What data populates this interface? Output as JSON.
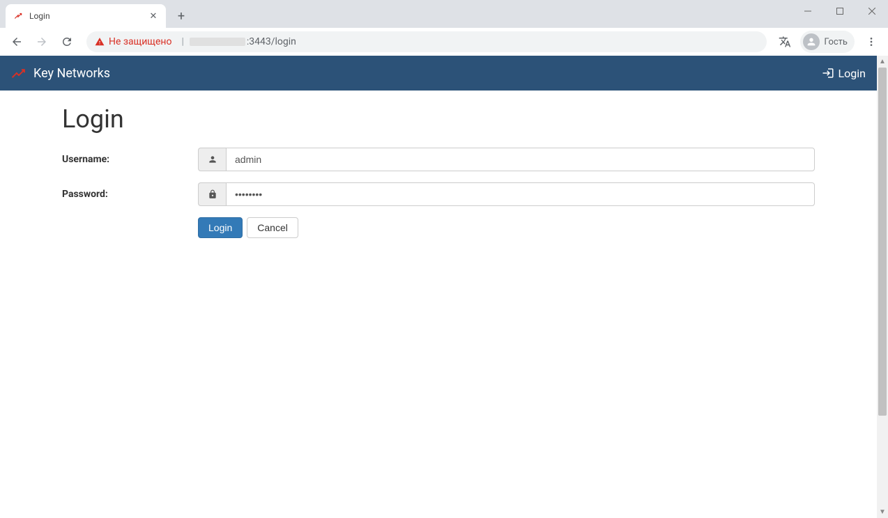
{
  "browser": {
    "tab": {
      "title": "Login"
    },
    "security_text": "Не защищено",
    "url_suffix": ":3443/login",
    "guest_label": "Гость"
  },
  "header": {
    "brand": "Key Networks",
    "login_link": "Login"
  },
  "page": {
    "title": "Login",
    "username_label": "Username:",
    "username_value": "admin",
    "password_label": "Password:",
    "password_value": "••••••••",
    "login_button": "Login",
    "cancel_button": "Cancel"
  }
}
